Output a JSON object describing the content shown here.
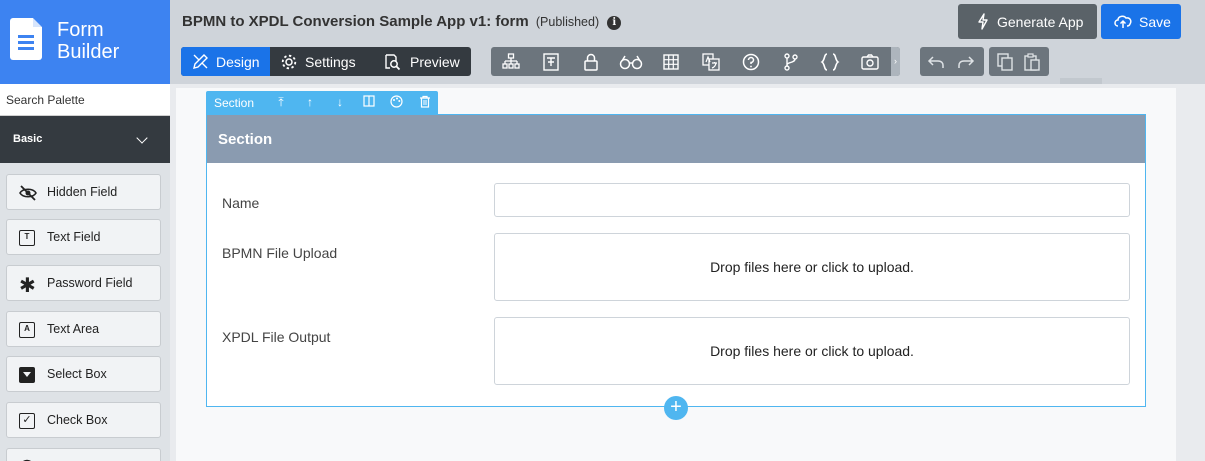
{
  "brand": {
    "title_line1": "Form",
    "title_line2": "Builder",
    "icon": "form-document-icon"
  },
  "search": {
    "placeholder": "Search Palette"
  },
  "palette": {
    "group_label": "Basic",
    "items": [
      {
        "label": "Hidden Field",
        "icon": "eye-slash-icon"
      },
      {
        "label": "Text Field",
        "icon": "text-field-icon"
      },
      {
        "label": "Password Field",
        "icon": "asterisk-icon"
      },
      {
        "label": "Text Area",
        "icon": "text-area-icon"
      },
      {
        "label": "Select Box",
        "icon": "select-box-icon"
      },
      {
        "label": "Check Box",
        "icon": "check-box-icon"
      },
      {
        "label": "",
        "icon": "radio-icon"
      }
    ]
  },
  "header": {
    "title": "BPMN to XPDL Conversion Sample App v1: form",
    "status": "(Published)",
    "generate_label": "Generate App",
    "save_label": "Save"
  },
  "tabs": [
    {
      "label": "Design",
      "icon": "design-pencil-ruler-icon",
      "active": true
    },
    {
      "label": "Settings",
      "icon": "gear-icon",
      "active": false
    },
    {
      "label": "Preview",
      "icon": "preview-magnifier-icon",
      "active": false
    }
  ],
  "tools": [
    "tree-icon",
    "form-fields-icon",
    "lock-icon",
    "binoculars-icon",
    "grid-icon",
    "translate-icon",
    "help-icon",
    "branch-icon",
    "braces-icon",
    "camera-icon"
  ],
  "section": {
    "toolbar_label": "Section",
    "title": "Section",
    "fields": [
      {
        "label": "Name",
        "type": "text",
        "value": ""
      },
      {
        "label": "BPMN File Upload",
        "type": "file",
        "drop_text": "Drop files here or click to upload."
      },
      {
        "label": "XPDL File Output",
        "type": "file",
        "drop_text": "Drop files here or click to upload."
      }
    ]
  },
  "colors": {
    "brand": "#3d83f1",
    "primary": "#1a73e8",
    "accent": "#4fb6f0",
    "section_header": "#8a9bb0",
    "dark": "#343a40"
  }
}
